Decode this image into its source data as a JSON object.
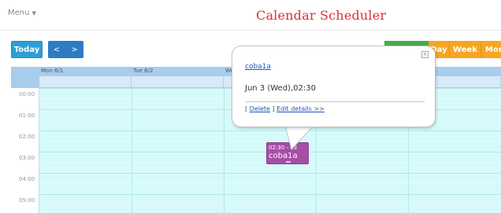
{
  "header": {
    "menu_label": "Menu",
    "menu_caret": "▼",
    "title": "Calendar Scheduler"
  },
  "toolbar": {
    "today_label": "Today",
    "prev_label": "<",
    "next_label": ">",
    "view_tabs": [
      "Day",
      "Week",
      "Mon"
    ]
  },
  "calendar": {
    "days": [
      "Mon 6/1",
      "Tue 6/2",
      "We"
    ],
    "hours": [
      "00:00",
      "01:00",
      "02:00",
      "03:00",
      "04:00",
      "05:00"
    ],
    "event": {
      "time": "02:30 - 03",
      "title": "coba1a",
      "color": "#a64ea6"
    }
  },
  "popup": {
    "close_label": "×",
    "title": "coba1a",
    "date": "Jun 3 (Wed),02:30",
    "delete_open": "[ ",
    "delete_label": "Delete",
    "delete_close": " ]",
    "edit_label": "Edit details >>"
  },
  "colors": {
    "title_red": "#d8303a",
    "today_blue": "#2f9ed5",
    "nav_blue": "#2b7cc4",
    "tab_orange": "#f5a623",
    "grid_cyan": "#d6fafa",
    "header_blue": "#a8ccec"
  }
}
